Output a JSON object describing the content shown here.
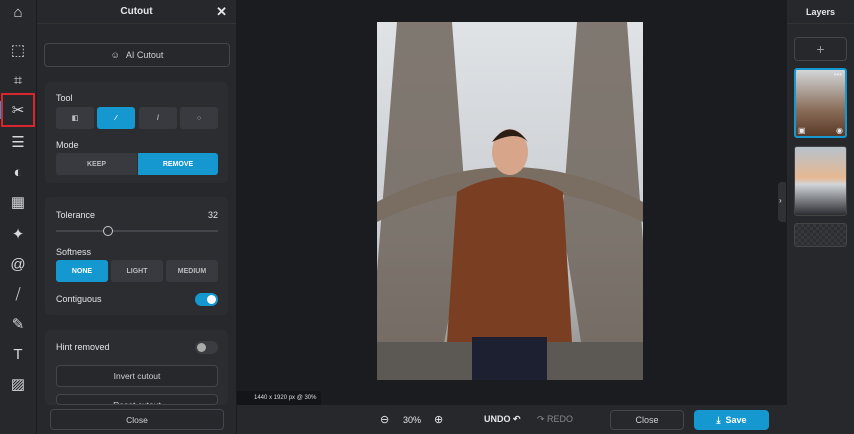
{
  "panel": {
    "title": "Cutout",
    "ai_cutout": "AI Cutout",
    "tool_label": "Tool",
    "mode_label": "Mode",
    "mode_keep": "KEEP",
    "mode_remove": "REMOVE",
    "tolerance_label": "Tolerance",
    "tolerance_value": "32",
    "tolerance_fraction": 0.32,
    "softness_label": "Softness",
    "softness_options": [
      "NONE",
      "LIGHT",
      "MEDIUM"
    ],
    "contiguous_label": "Contiguous",
    "contiguous_on": true,
    "hint_label": "Hint removed",
    "hint_on": false,
    "invert": "Invert cutout",
    "reset": "Reset cutout",
    "close": "Close"
  },
  "canvas": {
    "info": "1440 x 1920 px @ 30%"
  },
  "bottom": {
    "zoom": "30%",
    "undo": "UNDO",
    "redo": "REDO",
    "close": "Close",
    "save": "Save"
  },
  "layers": {
    "title": "Layers",
    "add": "+"
  },
  "colors": {
    "accent": "#1597d0",
    "highlight": "#d8262f"
  }
}
